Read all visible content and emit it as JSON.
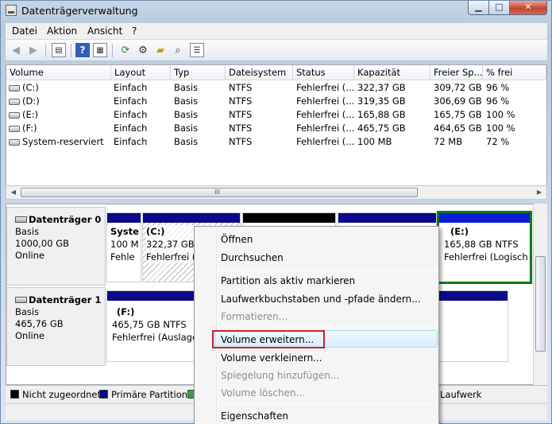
{
  "window": {
    "title": "Datenträgerverwaltung",
    "min": "▁",
    "max": "□",
    "close": "✕"
  },
  "menu": [
    "Datei",
    "Aktion",
    "Ansicht",
    "?"
  ],
  "toolbar": {
    "icons": [
      "back-icon",
      "forward-icon",
      "console-tree-icon",
      "help-icon",
      "properties-icon",
      "refresh-icon",
      "settings-icon",
      "open-icon",
      "search-icon",
      "list-icon"
    ]
  },
  "volumes": {
    "headers": [
      "Volume",
      "Layout",
      "Typ",
      "Dateisystem",
      "Status",
      "Kapazität",
      "Freier Sp...",
      "% frei"
    ],
    "rows": [
      [
        "(C:)",
        "Einfach",
        "Basis",
        "NTFS",
        "Fehlerfrei (...",
        "322,37 GB",
        "309,72 GB",
        "96 %"
      ],
      [
        "(D:)",
        "Einfach",
        "Basis",
        "NTFS",
        "Fehlerfrei (...",
        "319,35 GB",
        "306,69 GB",
        "96 %"
      ],
      [
        "(E:)",
        "Einfach",
        "Basis",
        "NTFS",
        "Fehlerfrei (...",
        "165,88 GB",
        "165,75 GB",
        "100 %"
      ],
      [
        "(F:)",
        "Einfach",
        "Basis",
        "NTFS",
        "Fehlerfrei (...",
        "465,75 GB",
        "464,65 GB",
        "100 %"
      ],
      [
        "System-reserviert",
        "Einfach",
        "Basis",
        "NTFS",
        "Fehlerfrei (...",
        "100 MB",
        "72 MB",
        "72 %"
      ]
    ]
  },
  "scroll_grip": "III",
  "disks": [
    {
      "name": "Datenträger 0",
      "type": "Basis",
      "size": "1000,00 GB",
      "state": "Online",
      "parts": [
        {
          "name": "Syste",
          "size": "100 M",
          "status": "Fehle"
        },
        {
          "name": "(C:)",
          "size": "322,37 GB NTFS",
          "status": "Fehlerfrei (S"
        },
        {
          "name": "(E:)",
          "size": "165,88 GB NTFS",
          "status": "Fehlerfrei (Logisch"
        }
      ]
    },
    {
      "name": "Datenträger 1",
      "type": "Basis",
      "size": "465,76 GB",
      "state": "Online",
      "parts": [
        {
          "name": "(F:)",
          "size": "465,75 GB NTFS",
          "status": "Fehlerfrei (Auslager"
        }
      ]
    }
  ],
  "legend": {
    "unallocated": "Nicht zugeordnet",
    "primary": "Primäre Partition",
    "logical": "Laufwerk"
  },
  "colors": {
    "primary": "#0a0a8a",
    "logical": "#0b1bd8",
    "unallocated": "#000000",
    "selected": "#0d7a1b",
    "highlight": "#cc1f2e"
  },
  "context_menu": {
    "items": [
      {
        "label": "Öffnen",
        "enabled": true
      },
      {
        "label": "Durchsuchen",
        "enabled": true
      },
      {
        "label": "Partition als aktiv markieren",
        "enabled": true
      },
      {
        "label": "Laufwerkbuchstaben und -pfade ändern...",
        "enabled": true
      },
      {
        "label": "Formatieren...",
        "enabled": false
      },
      {
        "label": "Volume erweitern...",
        "enabled": true
      },
      {
        "label": "Volume verkleinern...",
        "enabled": true
      },
      {
        "label": "Spiegelung hinzufügen...",
        "enabled": false
      },
      {
        "label": "Volume löschen...",
        "enabled": false
      },
      {
        "label": "Eigenschaften",
        "enabled": true
      }
    ]
  }
}
